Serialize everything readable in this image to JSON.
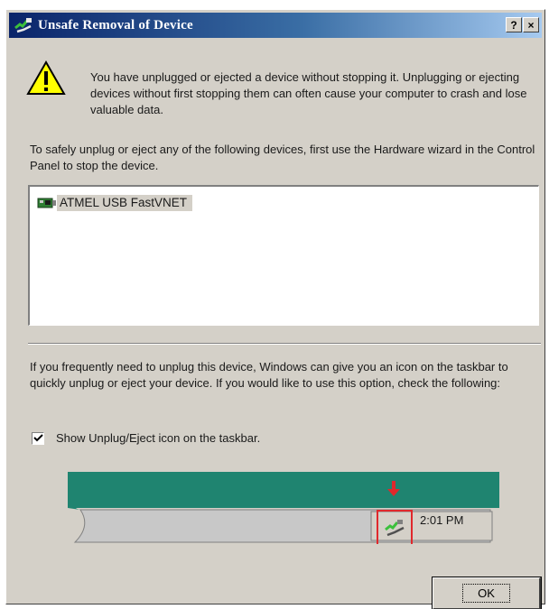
{
  "window": {
    "title": "Unsafe Removal of Device",
    "help_label": "?",
    "close_label": "×"
  },
  "warning": {
    "icon": "warning-icon",
    "text": "You have unplugged or ejected a device without stopping it. Unplugging or ejecting devices without first stopping them can often cause your computer to crash and lose valuable data."
  },
  "instructions": "To safely unplug or eject any of the following devices, first use the Hardware wizard in the Control Panel to stop the device.",
  "devices": [
    {
      "icon": "network-card-icon",
      "label": "ATMEL USB FastVNET"
    }
  ],
  "taskbar_info": "If you frequently need to unplug this device, Windows can give you an icon on the taskbar to quickly unplug or eject your device. If you would like to use this option, check the following:",
  "show_icon_option": {
    "label": "Show Unplug/Eject icon on the taskbar.",
    "checked": true
  },
  "tray_preview": {
    "icon": "unplug-eject-icon",
    "clock": "2:01 PM"
  },
  "ok_label": "OK",
  "colors": {
    "title_start": "#0a246a",
    "title_end": "#a6caf0",
    "face": "#d4d0c8",
    "tray_teal": "#1f8470",
    "highlight": "#e0282c"
  }
}
